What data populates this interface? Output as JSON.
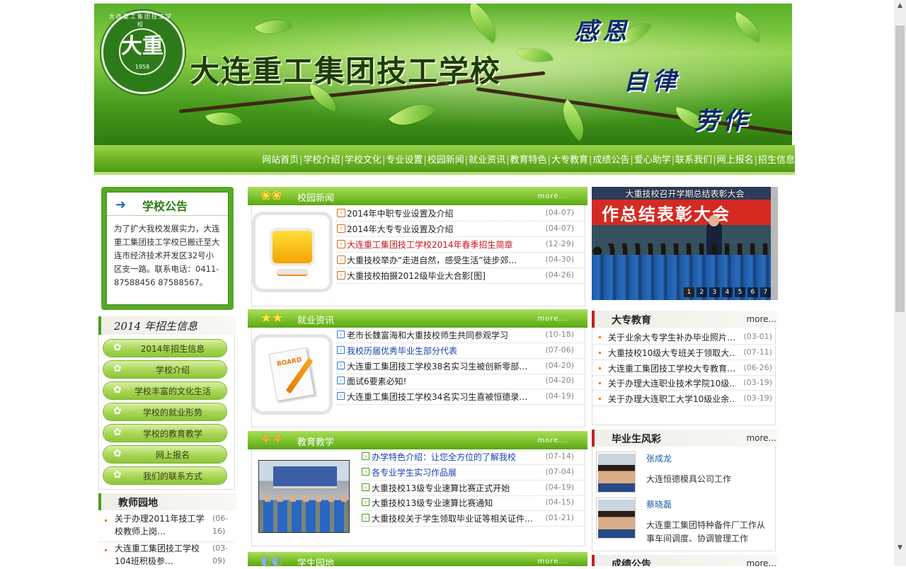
{
  "header": {
    "school_name": "大连重工集团技工学校",
    "logo_glyph": "大重",
    "logo_year": "1958",
    "logo_ring_text": "大连重工集团技工学校",
    "motto": [
      "感恩",
      "自律",
      "劳作"
    ]
  },
  "nav": {
    "items": [
      "网站首页",
      "学校介绍",
      "学校文化",
      "专业设置",
      "校园新闻",
      "就业资讯",
      "教育特色",
      "大专教育",
      "成绩公告",
      "爱心助学",
      "联系我们",
      "网上报名",
      "招生信息"
    ]
  },
  "notice": {
    "title": "学校公告",
    "text": "为了扩大我校发展实力，大连重工集团技工学校已搬迁至大连市经济技术开发区32号小区支一路。联系电话：0411-87588456 87588567。"
  },
  "recruit": {
    "title": "2014 年招生信息",
    "items": [
      "2014年招生信息",
      "学校介绍",
      "学校丰富的文化生活",
      "学校的就业形势",
      "学校的教育教学",
      "网上报名",
      "我们的联系方式"
    ]
  },
  "teachers": {
    "title": "教师园地",
    "items": [
      {
        "title": "关于办理2011年技工学校教师上岗…",
        "date": "(06-16)"
      },
      {
        "title": "大连重工集团技工学校104班积极参…",
        "date": "(03-09)"
      }
    ]
  },
  "campus_news": {
    "title": "校园新闻",
    "more": "more...",
    "items": [
      {
        "title": "2014年中职专业设置及介绍",
        "date": "(04-07)",
        "color": "#222222"
      },
      {
        "title": "2014年大专专业设置及介绍",
        "date": "(04-07)",
        "color": "#222222"
      },
      {
        "title": "大连重工集团技工学校2014年春季招生简章",
        "date": "(12-29)",
        "color": "#c8161d"
      },
      {
        "title": "大重技校举办“走进自然，感受生活”徒步郊…",
        "date": "(04-30)",
        "color": "#222222"
      },
      {
        "title": "大重技校拍摄2012级毕业大合影[图]",
        "date": "(04-26)",
        "color": "#222222"
      }
    ]
  },
  "employment": {
    "title": "就业资讯",
    "more": "more...",
    "thumb_label": "BOARD",
    "items": [
      {
        "title": "老市长魏富海和大重技校师生共同参观学习",
        "date": "(10-18)",
        "color": "#222222"
      },
      {
        "title": "我校历届优秀毕业生部分代表",
        "date": "(07-06)",
        "color": "#1a3fb0"
      },
      {
        "title": "大连重工集团技工学校38名实习生被创新零部…",
        "date": "(04-20)",
        "color": "#222222"
      },
      {
        "title": "面试6要素必知!",
        "date": "(04-20)",
        "color": "#222222"
      },
      {
        "title": "大连重工集团技工学校34名实习生喜被恒德录…",
        "date": "(04-19)",
        "color": "#222222"
      }
    ]
  },
  "teaching": {
    "title": "教育教学",
    "more": "more...",
    "items": [
      {
        "title": "办学特色介绍：让您全方位的了解我校",
        "date": "(07-14)",
        "color": "#1a3fb0"
      },
      {
        "title": "各专业学生实习作品展",
        "date": "(07-04)",
        "color": "#1a3fb0"
      },
      {
        "title": "大重技校13级专业速算比赛正式开始",
        "date": "(04-19)",
        "color": "#222222"
      },
      {
        "title": "大重技校13级专业速算比赛通知",
        "date": "(04-15)",
        "color": "#222222"
      },
      {
        "title": "大重技校关于学生领取毕业证等相关证件…",
        "date": "(01-21)",
        "color": "#222222"
      }
    ]
  },
  "students": {
    "title": "学生园地",
    "more": "more..."
  },
  "slideshow": {
    "caption": "大重技校召开学期总结表彰大会",
    "banner_text": "作总结表彰大会",
    "pages": [
      "1",
      "2",
      "3",
      "4",
      "5",
      "6",
      "7"
    ],
    "active_page": "1"
  },
  "college": {
    "title": "大专教育",
    "more": "more...",
    "items": [
      {
        "title": "关于业余大专学生补办毕业照片…",
        "date": "(03-01)"
      },
      {
        "title": "大重技校10级大专班关于领取大…",
        "date": "(07-11)"
      },
      {
        "title": "大连重工集团技工学校大专教育…",
        "date": "(06-26)"
      },
      {
        "title": "关于办理大连职业技术学院10级…",
        "date": "(03-19)"
      },
      {
        "title": "关于办理大连职工大学10级业余…",
        "date": "(03-19)"
      }
    ]
  },
  "graduates": {
    "title": "毕业生风彩",
    "more": "more...",
    "items": [
      {
        "name": "张成龙",
        "desc": "大连恒德模具公司工作"
      },
      {
        "name": "蔡晓磊",
        "desc": "大连重工集团特种备件厂工作从事车间调度、协调管理工作"
      }
    ]
  },
  "scores": {
    "title": "成绩公告",
    "more": "more..."
  },
  "colors": {
    "accent_green": "#6bb323",
    "link_red": "#c8161d",
    "link_blue": "#1a3fb0"
  }
}
